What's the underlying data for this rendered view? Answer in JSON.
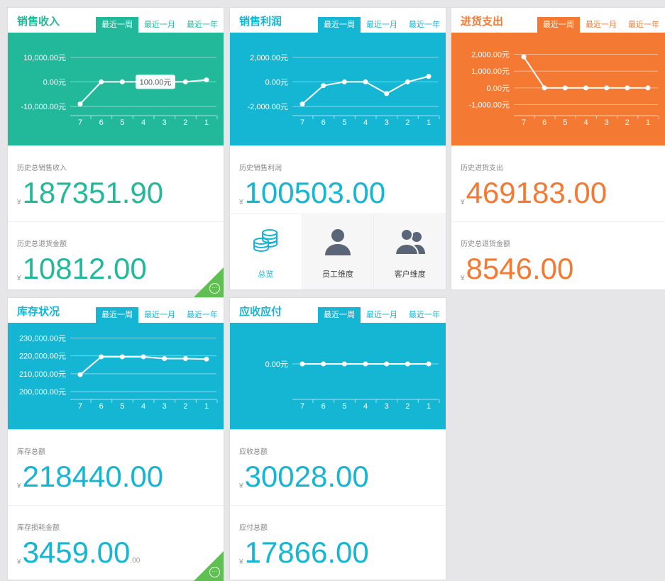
{
  "tabs": [
    "最近一周",
    "最近一月",
    "最近一年"
  ],
  "colors": {
    "green": "#22b99a",
    "blue": "#15b5d4",
    "orange": "#f47a33",
    "corner": "#5fbf52"
  },
  "cards": [
    {
      "key": "sales",
      "title": "销售收入",
      "color": "#22b99a",
      "stats": [
        {
          "label": "历史总销售收入",
          "currency": "¥",
          "value": "187351.90"
        },
        {
          "label": "历史总退货金额",
          "currency": "¥",
          "value": "10812.00"
        }
      ],
      "corner_icon": "more-icon"
    },
    {
      "key": "profit",
      "title": "销售利润",
      "color": "#15b5d4",
      "stats": [
        {
          "label": "历史销售利润",
          "currency": "¥",
          "value": "100503.00"
        }
      ],
      "nav": [
        {
          "label": "总览",
          "icon": "coins-stack-icon"
        },
        {
          "label": "员工维度",
          "icon": "person-icon"
        },
        {
          "label": "客户维度",
          "icon": "people-icon"
        }
      ]
    },
    {
      "key": "purchase",
      "title": "进货支出",
      "color": "#f47a33",
      "stats": [
        {
          "label": "历史进货支出",
          "currency": "¥",
          "value": "469183.00"
        },
        {
          "label": "历史总退货金额",
          "currency": "¥",
          "value": "8546.00"
        }
      ]
    },
    {
      "key": "inventory",
      "title": "库存状况",
      "color": "#15b5d4",
      "stats": [
        {
          "label": "库存总额",
          "currency": "¥",
          "value": "218440.00"
        },
        {
          "label": "库存损耗金额",
          "currency": "¥",
          "value": "3459.00",
          "suffix": ".00"
        }
      ],
      "corner_icon": "more-icon"
    },
    {
      "key": "receivable",
      "title": "应收应付",
      "color": "#15b5d4",
      "stats": [
        {
          "label": "应收总额",
          "currency": "¥",
          "value": "30028.00"
        },
        {
          "label": "应付总额",
          "currency": "¥",
          "value": "17866.00"
        }
      ]
    }
  ],
  "chart_data": [
    {
      "type": "line",
      "title": "销售收入",
      "categories": [
        "7",
        "6",
        "5",
        "4",
        "3",
        "2",
        "1"
      ],
      "values": [
        -9000,
        0,
        0,
        0,
        0,
        0,
        800
      ],
      "yticks": [
        "10,000.00元",
        "0.00元",
        "-10,000.00元"
      ],
      "ytick_values": [
        10000,
        0,
        -10000
      ],
      "ylim": [
        -12000,
        16000
      ],
      "tooltip": "100.00元",
      "tooltip_index": 3
    },
    {
      "type": "line",
      "title": "销售利润",
      "categories": [
        "7",
        "6",
        "5",
        "4",
        "3",
        "2",
        "1"
      ],
      "values": [
        -1800,
        -300,
        0,
        0,
        -950,
        0,
        450
      ],
      "yticks": [
        "2,000.00元",
        "0.00元",
        "-2,000.00元"
      ],
      "ytick_values": [
        2000,
        0,
        -2000
      ],
      "ylim": [
        -2400,
        3200
      ]
    },
    {
      "type": "line",
      "title": "进货支出",
      "categories": [
        "7",
        "6",
        "5",
        "4",
        "3",
        "2",
        "1"
      ],
      "values": [
        1850,
        0,
        0,
        0,
        0,
        0,
        0
      ],
      "yticks": [
        "2,000.00元",
        "1,000.00元",
        "0.00元",
        "-1,000.00元"
      ],
      "ytick_values": [
        2000,
        1000,
        0,
        -1000
      ],
      "ylim": [
        -1400,
        2700
      ]
    },
    {
      "type": "line",
      "title": "库存状况",
      "categories": [
        "7",
        "6",
        "5",
        "4",
        "3",
        "2",
        "1"
      ],
      "values": [
        209500,
        219500,
        219500,
        219500,
        218500,
        218500,
        218200
      ],
      "yticks": [
        "230,000.00元",
        "220,000.00元",
        "210,000.00元",
        "200,000.00元"
      ],
      "ytick_values": [
        230000,
        220000,
        210000,
        200000
      ],
      "ylim": [
        198000,
        233000
      ]
    },
    {
      "type": "line",
      "title": "应收应付",
      "categories": [
        "7",
        "6",
        "5",
        "4",
        "3",
        "2",
        "1"
      ],
      "values": [
        0,
        0,
        0,
        0,
        0,
        0,
        0
      ],
      "yticks": [
        "0.00元"
      ],
      "ytick_values": [
        0
      ],
      "ylim": [
        -1,
        1
      ]
    }
  ]
}
